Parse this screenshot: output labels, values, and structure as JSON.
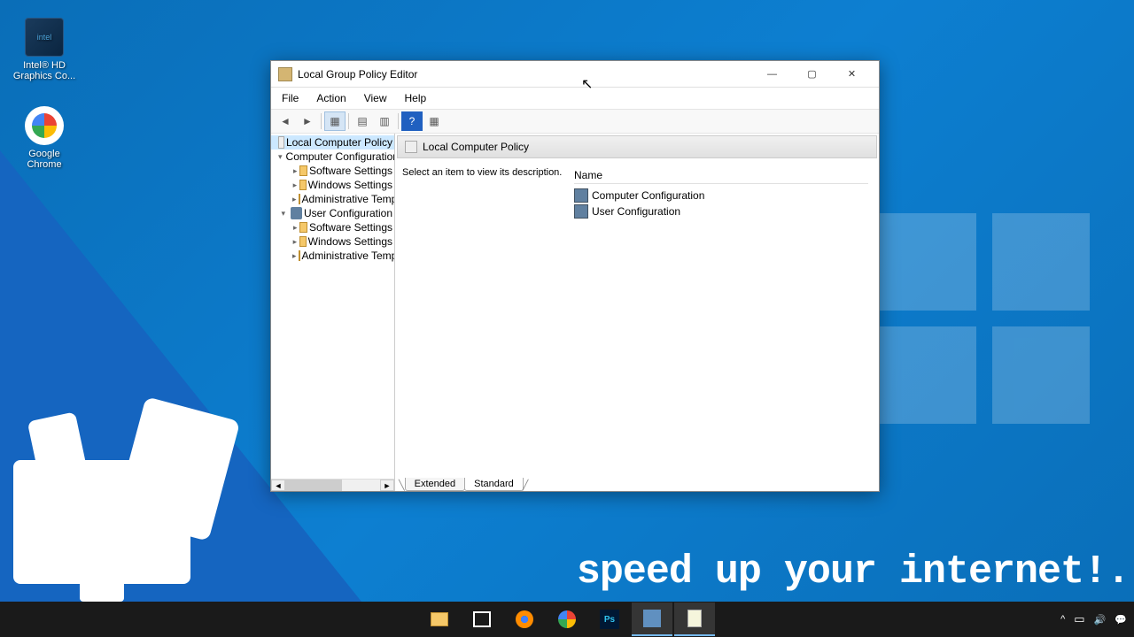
{
  "desktop": {
    "icons": [
      {
        "label": "Intel® HD Graphics Co..."
      },
      {
        "label": "Google Chrome"
      }
    ]
  },
  "caption": "speed up your internet!.",
  "window": {
    "title": "Local Group Policy Editor",
    "menu": [
      "File",
      "Action",
      "View",
      "Help"
    ],
    "tree": {
      "root": "Local Computer Policy",
      "cc": "Computer Configuration",
      "uc": "User Configuration",
      "ss": "Software Settings",
      "ws": "Windows Settings",
      "at": "Administrative Templates"
    },
    "mainTitle": "Local Computer Policy",
    "description": "Select an item to view its description.",
    "listHeader": "Name",
    "listItems": [
      "Computer Configuration",
      "User Configuration"
    ],
    "tabs": [
      "Extended",
      "Standard"
    ]
  },
  "tray": {
    "time": "",
    "chevron": "^"
  }
}
